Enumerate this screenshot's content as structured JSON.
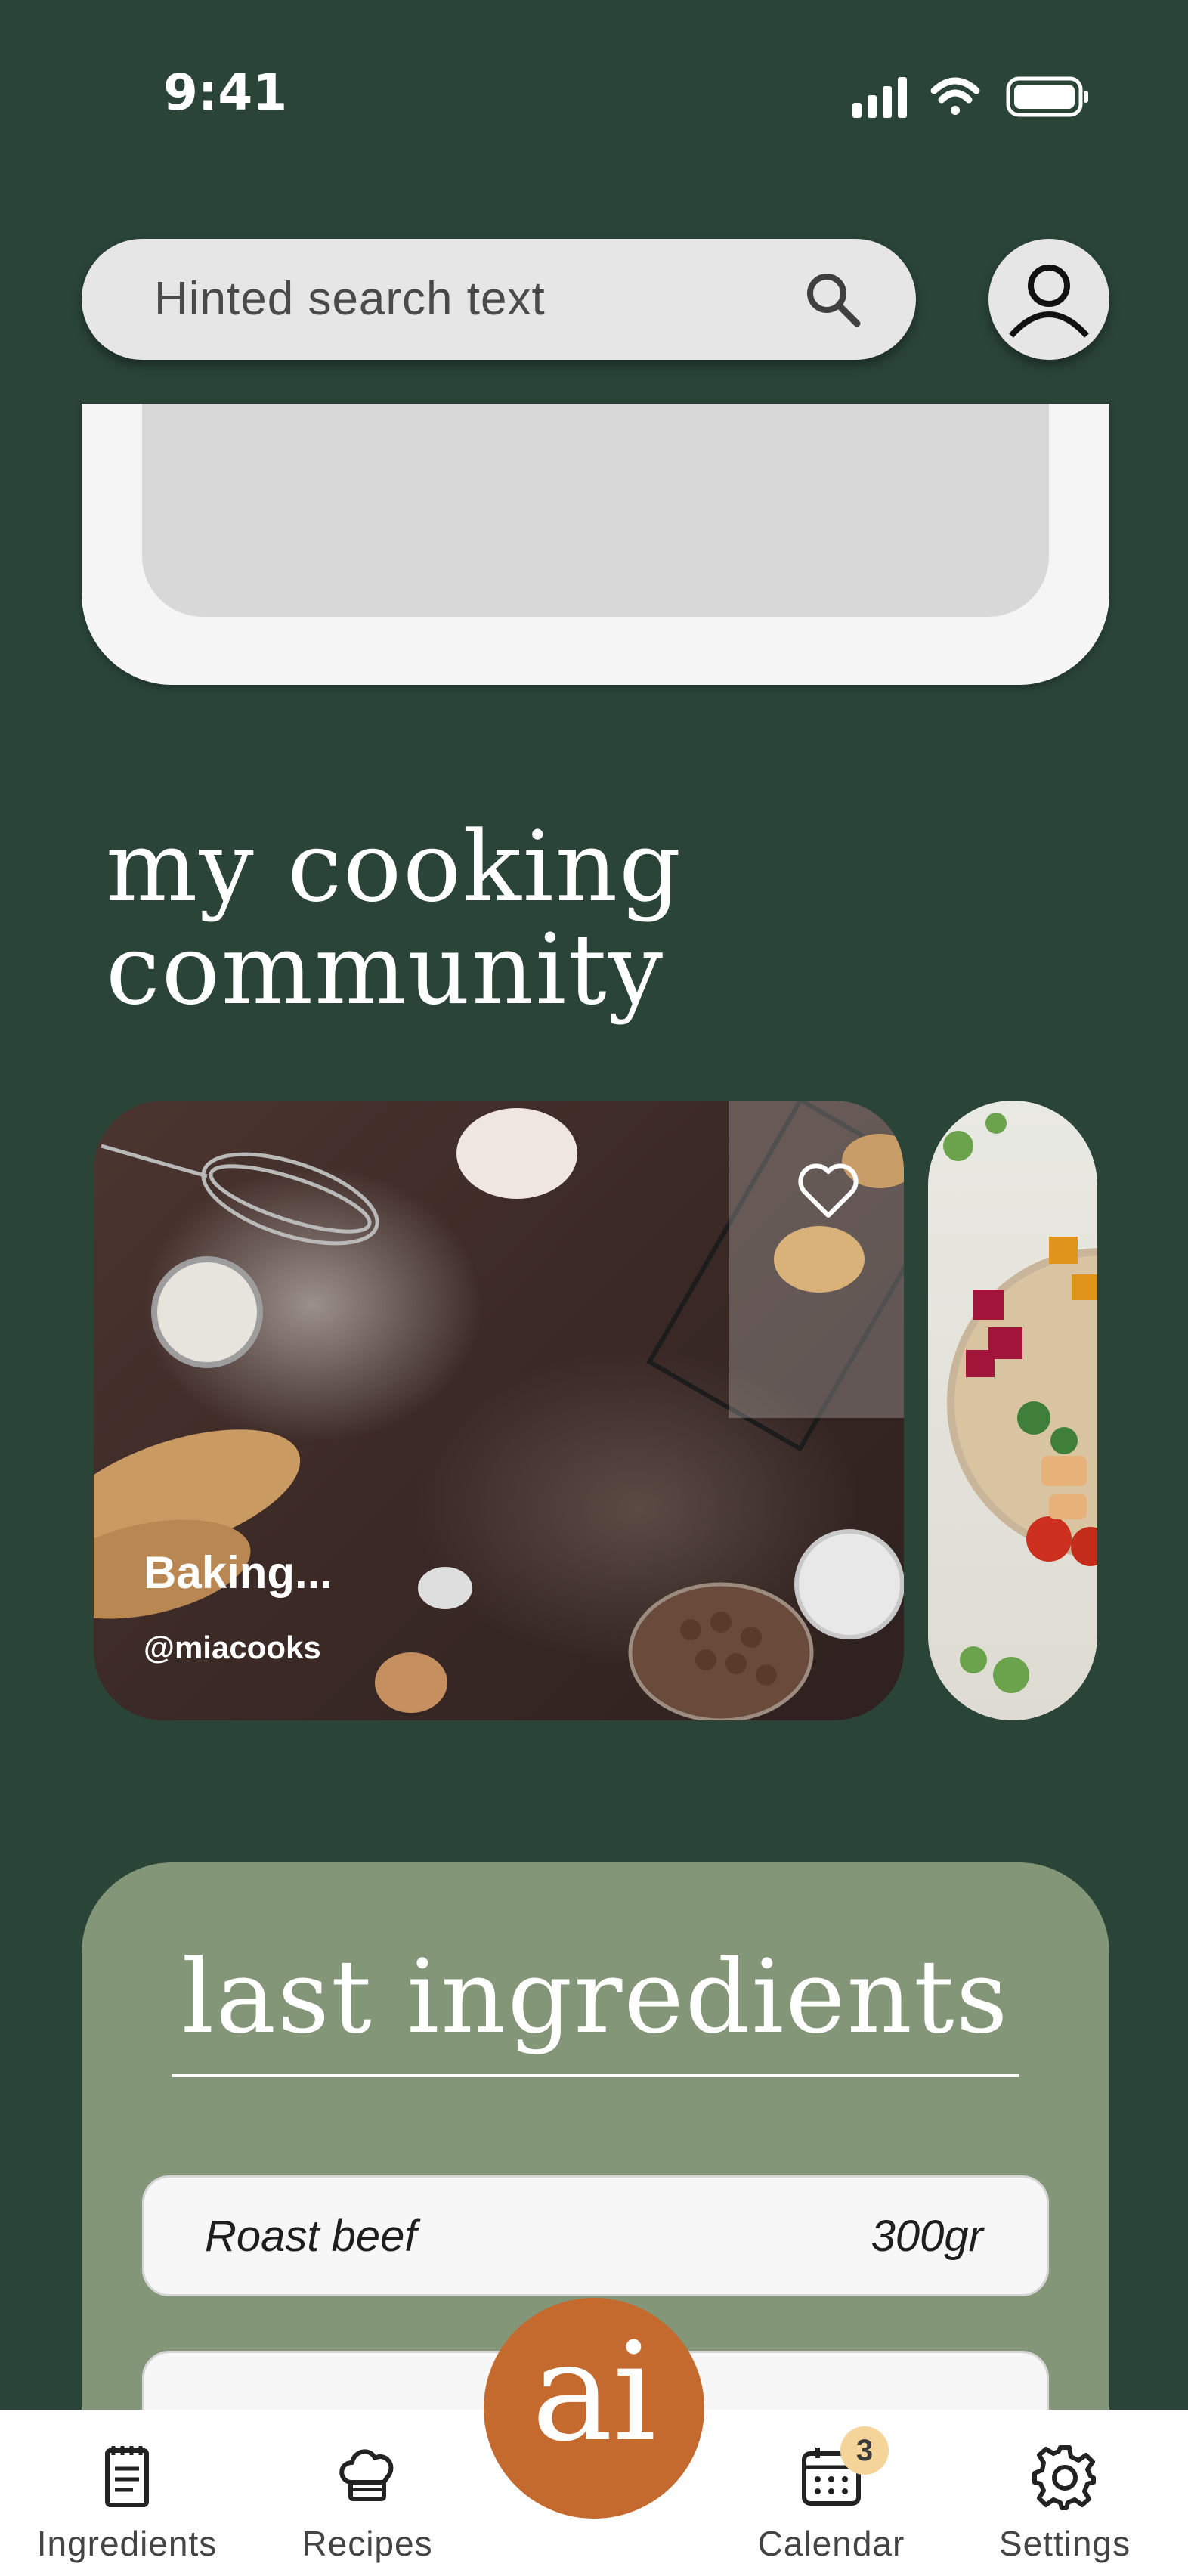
{
  "status_bar": {
    "time": "9:41"
  },
  "search": {
    "placeholder": "Hinted search text"
  },
  "community": {
    "title_line1": "my cooking",
    "title_line2": "community",
    "cards": [
      {
        "title": "Baking...",
        "author": "@miacooks",
        "liked": false
      }
    ]
  },
  "ingredients": {
    "title": "last ingredients",
    "items": [
      {
        "name": "Roast beef",
        "quantity": "300gr"
      }
    ]
  },
  "fab": {
    "label": "ai"
  },
  "nav": {
    "items": [
      {
        "label": "Ingredients",
        "icon": "notepad-icon"
      },
      {
        "label": "Recipes",
        "icon": "chef-hat-icon"
      },
      {
        "label": "Calendar",
        "icon": "calendar-icon",
        "badge": "3"
      },
      {
        "label": "Settings",
        "icon": "gear-icon"
      }
    ]
  },
  "colors": {
    "background": "#2a4438",
    "panel": "#849678",
    "accent": "#c46a2f",
    "badge": "#f5d49a"
  }
}
